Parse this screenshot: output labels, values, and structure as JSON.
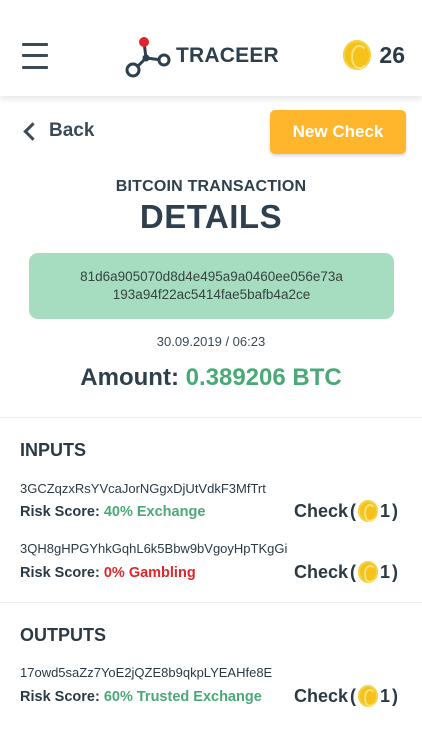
{
  "header": {
    "logo_text": "TRACEER",
    "coin_count": "26"
  },
  "nav": {
    "back_label": "Back",
    "new_check_label": "New Check"
  },
  "transaction": {
    "subtitle": "BITCOIN TRANSACTION",
    "title": "DETAILS",
    "hash_line1": "81d6a905070d8d4e495a9a0460ee056e73a",
    "hash_line2": "193a94f22ac5414fae5bafb4a2ce",
    "datetime": "30.09.2019 / 06:23",
    "amount_label": "Amount:",
    "amount_value": "0.389206 BTC"
  },
  "inputs": {
    "title": "INPUTS",
    "items": [
      {
        "address": "3GCZqzxRsYVcaJorNGgxDjUtVdkF3MfTrt",
        "risk_label": "Risk Score:",
        "risk_value": "40% Exchange",
        "check_label": "Check",
        "check_cost": "1"
      },
      {
        "address": "3QH8gHPGYhkGqhL6k5Bbw9bVgoyHpTKgGi",
        "risk_label": "Risk Score:",
        "risk_value": "0% Gambling",
        "check_label": "Check",
        "check_cost": "1"
      }
    ]
  },
  "outputs": {
    "title": "OUTPUTS",
    "items": [
      {
        "address": "17owd5saZz7YoE2jQZE8b9qkpLYEAHfe8E",
        "risk_label": "Risk Score:",
        "risk_value": "60% Trusted Exchange",
        "check_label": "Check",
        "check_cost": "1"
      }
    ]
  },
  "icons": {
    "menu": "hamburger-menu-icon",
    "logo": "traceer-network-logo-icon",
    "coin": "coin-icon",
    "back": "chevron-left-icon"
  },
  "colors": {
    "accent_orange": "#ffb62c",
    "hash_bg": "#a6dcbf",
    "green": "#4aaa77",
    "red": "#e0262b",
    "text_dark": "#2e3f4e",
    "coin": "#f6c21a"
  }
}
